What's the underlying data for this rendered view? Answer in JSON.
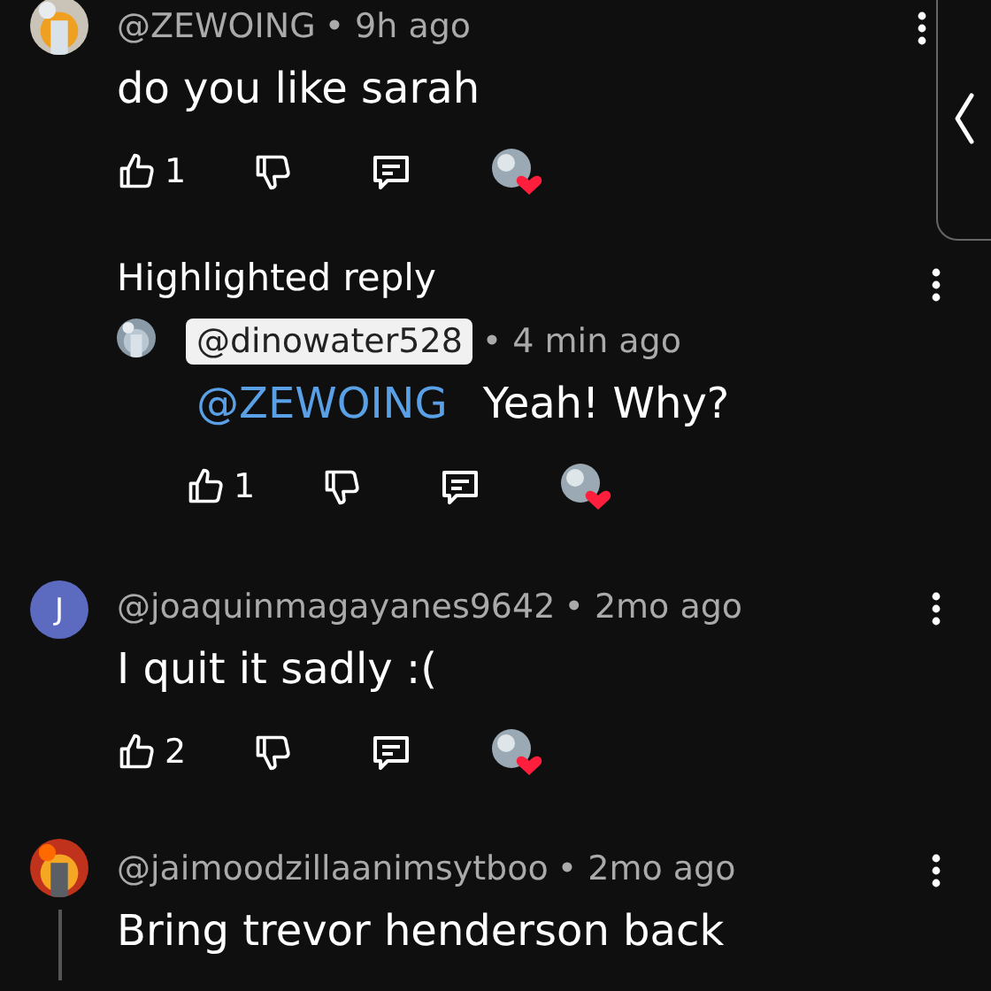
{
  "comments": [
    {
      "kind": "comment",
      "author": "@ZEWOING",
      "time": "• 9h ago",
      "text": "do you like sarah",
      "actions": {
        "likes": "1",
        "hearted": true
      }
    },
    {
      "kind": "highlighted",
      "label": "Highlighted reply",
      "author": "@dinowater528",
      "author_highlighted": true,
      "time": "• 4 min ago",
      "mention": "@ZEWOING",
      "text": "Yeah! Why?",
      "actions": {
        "likes": "1",
        "hearted": true
      }
    },
    {
      "kind": "comment",
      "avatar": {
        "kind": "letter",
        "letter": "J",
        "color": "#5c6bc0"
      },
      "author": "@joaquinmagayanes9642",
      "time": "• 2mo ago",
      "text": "I quit it sadly :(",
      "actions": {
        "likes": "2",
        "hearted": true
      }
    },
    {
      "kind": "comment",
      "author": "@jaimoodzillaanimsytboo",
      "time": "• 2mo ago",
      "text": "Bring trevor henderson back",
      "thread": true
    }
  ]
}
